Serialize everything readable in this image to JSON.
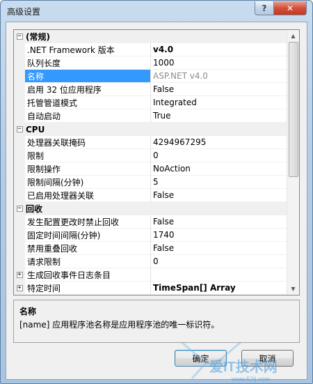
{
  "window": {
    "title": "高级设置"
  },
  "titlebar": {
    "help_label": "?",
    "close_label": "✕"
  },
  "icons": {
    "collapse": "⊟ minus-box",
    "expand": "⊞ plus-box"
  },
  "grid": {
    "rows": [
      {
        "kind": "category",
        "label": "(常规)",
        "expanded": true
      },
      {
        "kind": "prop",
        "name": ".NET Framework 版本",
        "value": "v4.0",
        "bold": true
      },
      {
        "kind": "prop",
        "name": "队列长度",
        "value": "1000"
      },
      {
        "kind": "prop",
        "name": "名称",
        "value": "ASP.NET v4.0",
        "selected": true,
        "readonly": true
      },
      {
        "kind": "prop",
        "name": "启用 32 位应用程序",
        "value": "False"
      },
      {
        "kind": "prop",
        "name": "托管管道模式",
        "value": "Integrated"
      },
      {
        "kind": "prop",
        "name": "自动启动",
        "value": "True"
      },
      {
        "kind": "category",
        "label": "CPU",
        "expanded": true
      },
      {
        "kind": "prop",
        "name": "处理器关联掩码",
        "value": "4294967295"
      },
      {
        "kind": "prop",
        "name": "限制",
        "value": "0"
      },
      {
        "kind": "prop",
        "name": "限制操作",
        "value": "NoAction"
      },
      {
        "kind": "prop",
        "name": "限制间隔(分钟)",
        "value": "5"
      },
      {
        "kind": "prop",
        "name": "已启用处理器关联",
        "value": "False"
      },
      {
        "kind": "category",
        "label": "回收",
        "expanded": true
      },
      {
        "kind": "prop",
        "name": "发生配置更改时禁止回收",
        "value": "False"
      },
      {
        "kind": "prop",
        "name": "固定时间间隔(分钟)",
        "value": "1740"
      },
      {
        "kind": "prop",
        "name": "禁用重叠回收",
        "value": "False"
      },
      {
        "kind": "prop",
        "name": "请求限制",
        "value": "0"
      },
      {
        "kind": "prop",
        "name": "生成回收事件日志条目",
        "value": "",
        "expandable": true
      },
      {
        "kind": "prop",
        "name": "特定时间",
        "value": "TimeSpan[] Array",
        "bold": true,
        "expandable": true
      }
    ]
  },
  "description": {
    "title": "名称",
    "text": "[name] 应用程序池名称是应用程序池的唯一标识符。"
  },
  "buttons": {
    "ok_label": "确定",
    "cancel_label": "取消"
  },
  "watermark": {
    "text": "爱IT技术网",
    "url": "www.52ij.com"
  },
  "colors": {
    "selection": "#3399ff",
    "title_bg": "#b9d1ea",
    "close": "#c7402a"
  }
}
